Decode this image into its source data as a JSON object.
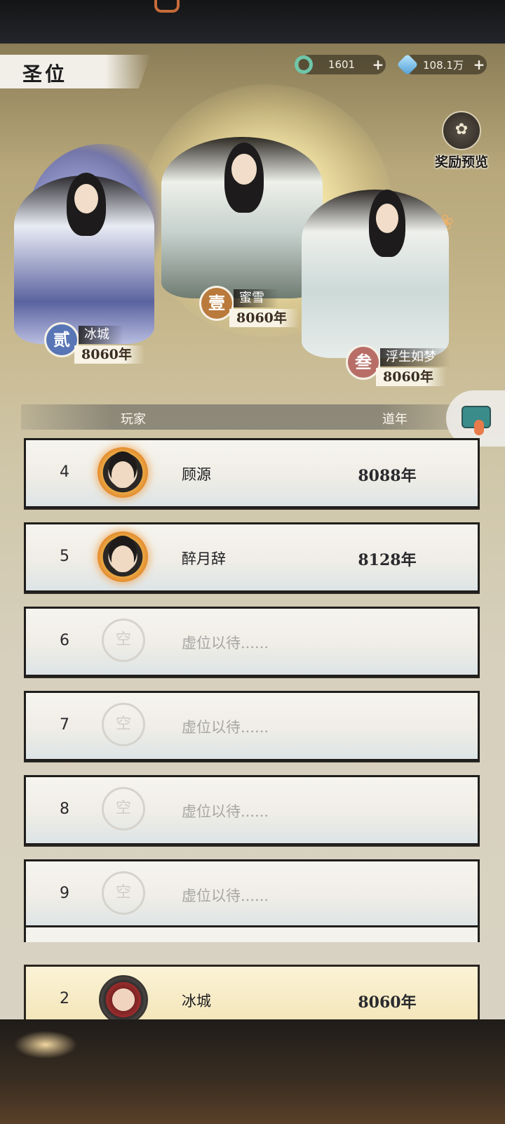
{
  "header": {
    "title": "圣位",
    "currency_jade": "1601",
    "currency_crystal": "108.1万",
    "plus_label": "+",
    "reward_label": "奖励预览"
  },
  "podium": {
    "first": {
      "badge": "壹",
      "name": "蜜雪",
      "years": "8060年"
    },
    "second": {
      "badge": "贰",
      "name": "冰城",
      "years": "8060年"
    },
    "third": {
      "badge": "叁",
      "name": "浮生如梦",
      "years": "8060年"
    }
  },
  "list_header": {
    "player": "玩家",
    "years": "道年"
  },
  "rows": [
    {
      "rank": "4",
      "name": "顾源",
      "years": "8088年"
    },
    {
      "rank": "5",
      "name": "醉月辞",
      "years": "8128年"
    },
    {
      "rank": "6",
      "name": "虚位以待......",
      "years": ""
    },
    {
      "rank": "7",
      "name": "虚位以待......",
      "years": ""
    },
    {
      "rank": "8",
      "name": "虚位以待......",
      "years": ""
    },
    {
      "rank": "9",
      "name": "虚位以待......",
      "years": ""
    }
  ],
  "empty_avatar_glyph": "空",
  "self_row": {
    "rank": "2",
    "name": "冰城",
    "years": "8060年"
  },
  "icons": [
    "jade-ring-icon",
    "crystal-icon",
    "reward-bag-icon",
    "share-icon"
  ],
  "colors": {
    "badge_second": "#5876b6",
    "badge_first": "#b97a3c",
    "badge_third": "#b86e66",
    "self_row": "#f2e3b4"
  }
}
